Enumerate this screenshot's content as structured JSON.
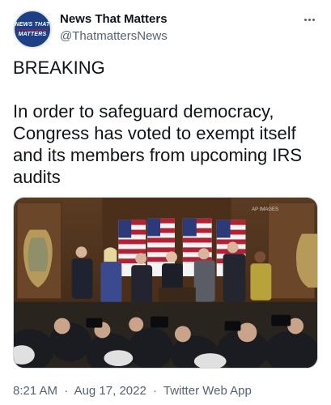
{
  "tweet": {
    "author": {
      "display_name": "News That Matters",
      "handle": "@ThatmattersNews",
      "avatar_text": [
        "NEWS THAT",
        "MATTERS"
      ]
    },
    "text_lines": [
      "BREAKING",
      "",
      "In order to safeguard democracy,",
      "Congress has voted to exempt itself",
      "and its members from upcoming IRS",
      "audits"
    ],
    "media": {
      "watermark": "AP IMAGES"
    },
    "time": "8:21 AM",
    "date": "Aug 17, 2022",
    "source": "Twitter Web App",
    "separator": "·"
  },
  "icons": {
    "more": "more-horizontal-icon"
  },
  "colors": {
    "text_primary": "#0f1419",
    "text_secondary": "#536471",
    "border": "#cfd9de",
    "avatar_bg": "#1d3f86"
  }
}
